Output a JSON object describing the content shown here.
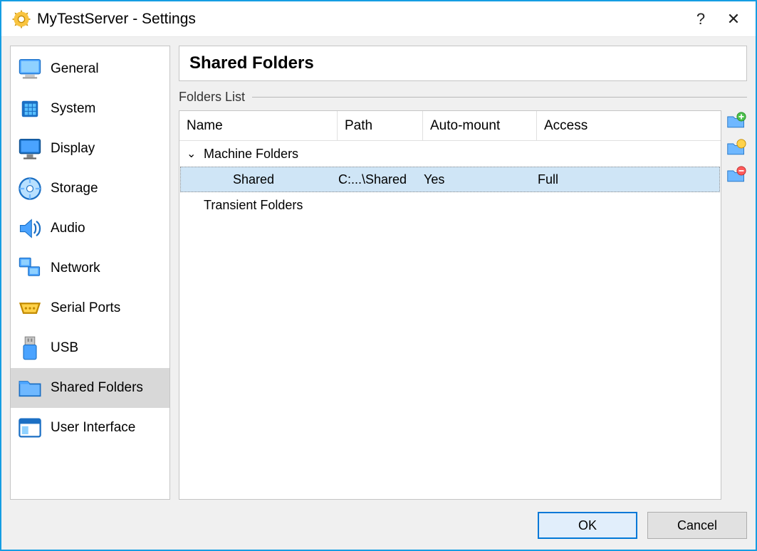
{
  "title": "MyTestServer - Settings",
  "sidebar": {
    "items": [
      {
        "label": "General"
      },
      {
        "label": "System"
      },
      {
        "label": "Display"
      },
      {
        "label": "Storage"
      },
      {
        "label": "Audio"
      },
      {
        "label": "Network"
      },
      {
        "label": "Serial Ports"
      },
      {
        "label": "USB"
      },
      {
        "label": "Shared Folders"
      },
      {
        "label": "User Interface"
      }
    ]
  },
  "content": {
    "header": "Shared Folders",
    "group_label": "Folders List",
    "columns": {
      "name": "Name",
      "path": "Path",
      "mount": "Auto-mount",
      "access": "Access"
    },
    "groups": [
      {
        "label": "Machine Folders",
        "expanded": true,
        "rows": [
          {
            "name": "Shared",
            "path": "C:...\\Shared",
            "mount": "Yes",
            "access": "Full",
            "selected": true
          }
        ]
      },
      {
        "label": "Transient Folders",
        "expanded": false,
        "rows": []
      }
    ]
  },
  "buttons": {
    "ok": "OK",
    "cancel": "Cancel"
  }
}
